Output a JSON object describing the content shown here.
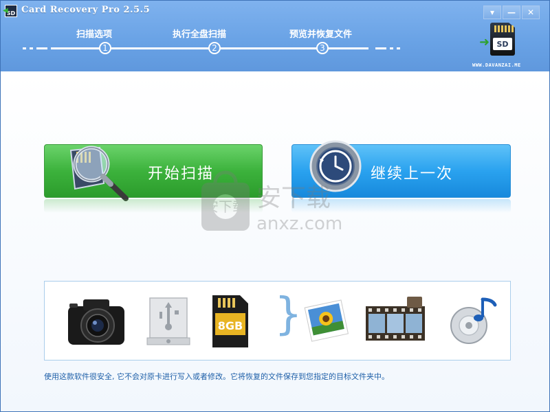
{
  "titlebar": {
    "title": "Card Recovery Pro 2.5.5",
    "app_icon_text": "SD",
    "buttons": {
      "menu": "▾",
      "minimize": "—",
      "close": "✕"
    }
  },
  "steps": [
    {
      "label": "扫描选项",
      "number": "1"
    },
    {
      "label": "执行全盘扫描",
      "number": "2"
    },
    {
      "label": "预览并恢复文件",
      "number": "3"
    }
  ],
  "logo": {
    "card_text": "SD",
    "site": "WWW.DAVANZAI.ME"
  },
  "actions": {
    "start_scan": "开始扫描",
    "resume_last": "继续上一次"
  },
  "watermark": {
    "brand": "安下载",
    "domain": "anxz.com"
  },
  "devices": {
    "sd_card_label": "8GB",
    "items": [
      "camera-icon",
      "usb-drive-icon",
      "sd-card-icon",
      "photo-icon",
      "film-icon",
      "music-icon"
    ]
  },
  "info_text": "使用这款软件很安全, 它不会对原卡进行写入或者修改。它将恢复的文件保存到您指定的目标文件夹中。"
}
